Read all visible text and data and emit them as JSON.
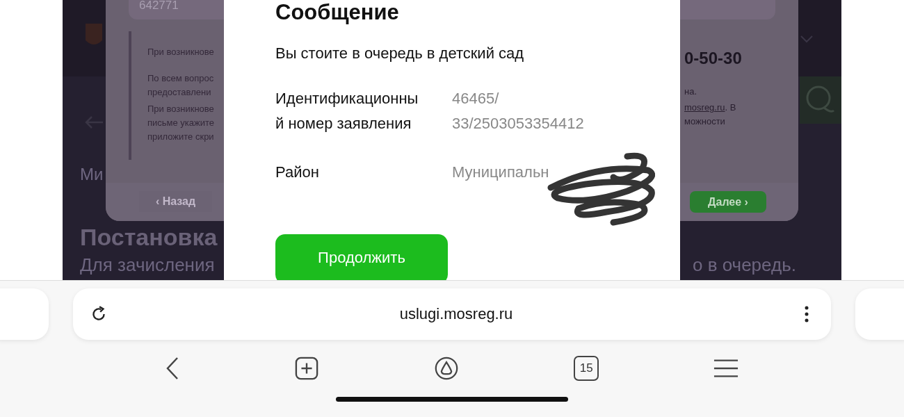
{
  "background_page": {
    "back_link_fragment": "Ми",
    "title_fragment": "Постановка",
    "text_fragment_left": "Для зачисления",
    "text_fragment_right": "о в очередь."
  },
  "background_dialog": {
    "field_value": "642771",
    "notes_left": [
      "При возникнове",
      "По всем вопрос\nпредоставлени",
      "При возникнове\nписьме укажите\nприложите скри"
    ],
    "phone_fragment": "0-50-30",
    "notes_right": [
      {
        "text": "на."
      },
      {
        "text": ". В",
        "link": "mosreg.ru"
      },
      {
        "text": "можности"
      }
    ],
    "back_button": "‹ Назад",
    "next_button": "Далее ›"
  },
  "message": {
    "title": "Сообщение",
    "text": "Вы стоите в очередь в детский сад",
    "rows": [
      {
        "label": "Идентификационны\nй номер заявления",
        "value": "46465/\n33/2503053354412"
      },
      {
        "label": "Район",
        "value": "Муниципальн"
      }
    ],
    "button": "Продолжить"
  },
  "browser": {
    "url": "uslugi.mosreg.ru",
    "tabs_count": "15"
  }
}
